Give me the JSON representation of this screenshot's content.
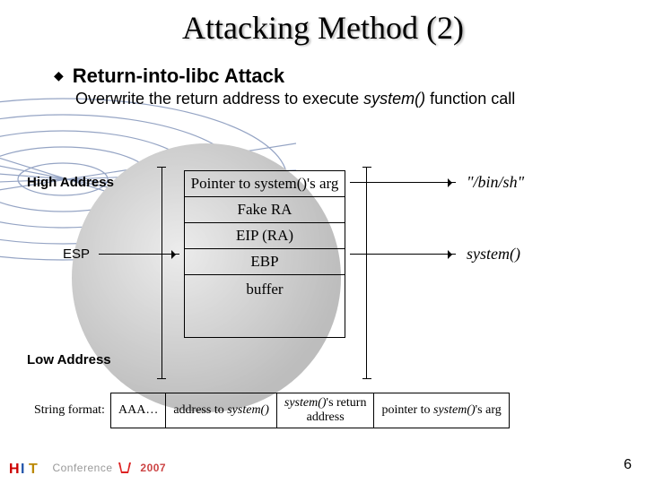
{
  "title": "Attacking Method (2)",
  "bullet": {
    "heading": "Return-into-libc Attack",
    "description_pre": "Overwrite the return address to execute ",
    "description_em": "system()",
    "description_post": " function call"
  },
  "labels": {
    "high": "High Address",
    "esp": "ESP",
    "low": "Low Address",
    "string_format": "String format:"
  },
  "stack": {
    "cells": [
      "Pointer to system()'s arg",
      "Fake RA",
      "EIP (RA)",
      "EBP"
    ],
    "buffer": "buffer"
  },
  "notes": {
    "binsh": "\"/bin/sh\"",
    "system": "system()"
  },
  "format_row": {
    "c0": "AAA…",
    "c1": "address to system()",
    "c2": "system()'s return address",
    "c3": "pointer to system()'s arg"
  },
  "footer": {
    "conf": "Conference",
    "year": "2007"
  },
  "page": "6"
}
